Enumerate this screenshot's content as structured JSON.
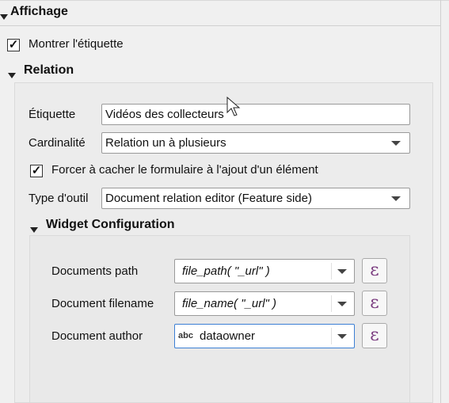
{
  "display_section": {
    "title": "Affichage",
    "show_label": {
      "label": "Montrer l'étiquette",
      "checked": true
    }
  },
  "relation_section": {
    "title": "Relation",
    "label_field": {
      "label": "Étiquette",
      "value": "Vidéos des collecteurs"
    },
    "cardinality": {
      "label": "Cardinalité",
      "value": "Relation un à plusieurs"
    },
    "force_hide": {
      "label": "Forcer à cacher le formulaire à l'ajout d'un élément",
      "checked": true
    },
    "tool_type": {
      "label": "Type d'outil",
      "value": "Document relation editor (Feature side)"
    }
  },
  "widget_config": {
    "title": "Widget Configuration",
    "documents_path": {
      "label": "Documents path",
      "value": "file_path(  \"_url\" )"
    },
    "document_filename": {
      "label": "Document filename",
      "value": "file_name(  \"_url\" )"
    },
    "document_author": {
      "label": "Document author",
      "type_badge": "abc",
      "value": "dataowner"
    },
    "expression_button_glyph": "ε"
  },
  "icons": {
    "expand": "triangle-down-icon",
    "expression": "epsilon-expression-icon",
    "cursor": "mouse-pointer-icon"
  }
}
